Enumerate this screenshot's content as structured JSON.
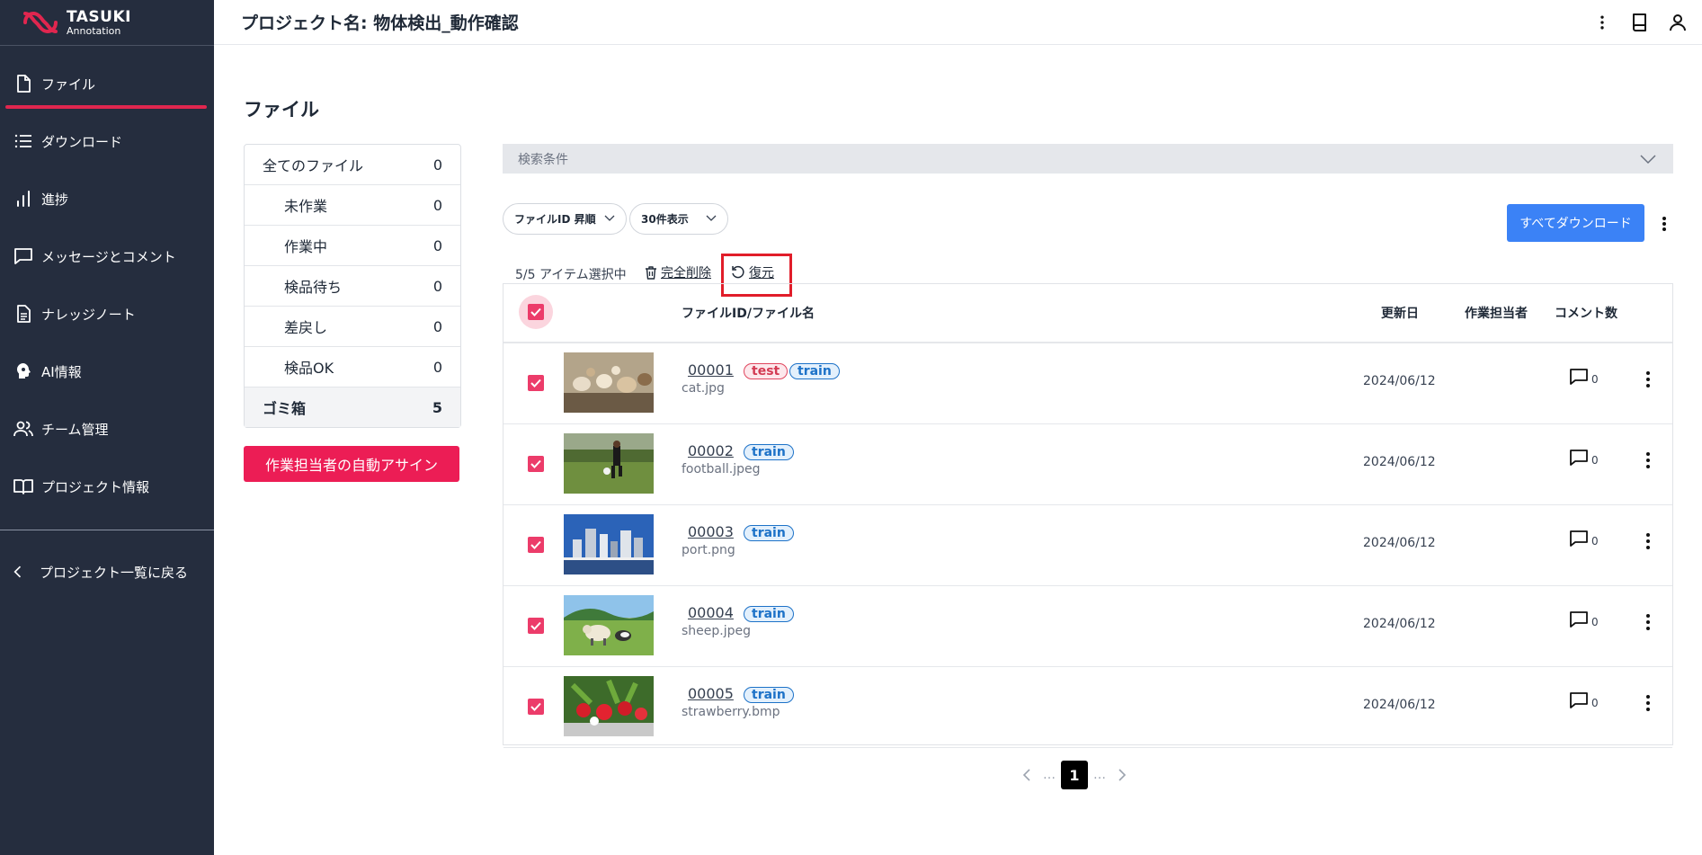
{
  "app": {
    "logo_text": "TASUKI",
    "logo_sub": "Annotation"
  },
  "header": {
    "project_title": "プロジェクト名: 物体検出_動作確認"
  },
  "sidebar": {
    "items": [
      {
        "label": "ファイル",
        "icon": "file-icon",
        "active": true
      },
      {
        "label": "ダウンロード",
        "icon": "list-icon"
      },
      {
        "label": "進捗",
        "icon": "bar-chart-icon"
      },
      {
        "label": "メッセージとコメント",
        "icon": "message-icon"
      },
      {
        "label": "ナレッジノート",
        "icon": "document-icon"
      },
      {
        "label": "AI情報",
        "icon": "ai-head-icon"
      },
      {
        "label": "チーム管理",
        "icon": "users-icon"
      },
      {
        "label": "プロジェクト情報",
        "icon": "book-icon"
      }
    ],
    "back_label": "プロジェクト一覧に戻る"
  },
  "main": {
    "section_title": "ファイル",
    "filters": [
      {
        "label": "全てのファイル",
        "count": "0"
      },
      {
        "label": "未作業",
        "count": "0"
      },
      {
        "label": "作業中",
        "count": "0"
      },
      {
        "label": "検品待ち",
        "count": "0"
      },
      {
        "label": "差戻し",
        "count": "0"
      },
      {
        "label": "検品OK",
        "count": "0"
      },
      {
        "label": "ゴミ箱",
        "count": "5"
      }
    ],
    "auto_assign_label": "作業担当者の自動アサイン",
    "search_label": "検索条件",
    "sort_select": "ファイルID 昇順",
    "page_size_select": "30件表示",
    "download_all_label": "すべてダウンロード",
    "selection_text": "5/5 アイテム選択中",
    "delete_label": "完全削除",
    "restore_label": "復元",
    "columns": {
      "file": "ファイルID/ファイル名",
      "updated": "更新日",
      "assignee": "作業担当者",
      "comments": "コメント数"
    },
    "rows": [
      {
        "id": "00001",
        "name": "cat.jpg",
        "tags": [
          "test",
          "train"
        ],
        "date": "2024/06/12",
        "comments": "0"
      },
      {
        "id": "00002",
        "name": "football.jpeg",
        "tags": [
          "train"
        ],
        "date": "2024/06/12",
        "comments": "0"
      },
      {
        "id": "00003",
        "name": "port.png",
        "tags": [
          "train"
        ],
        "date": "2024/06/12",
        "comments": "0"
      },
      {
        "id": "00004",
        "name": "sheep.jpeg",
        "tags": [
          "train"
        ],
        "date": "2024/06/12",
        "comments": "0"
      },
      {
        "id": "00005",
        "name": "strawberry.bmp",
        "tags": [
          "train"
        ],
        "date": "2024/06/12",
        "comments": "0"
      }
    ],
    "pagination": {
      "current": "1",
      "dots": "…"
    }
  },
  "colors": {
    "sidebar_bg": "#252d3e",
    "accent_pink": "#ec1d55",
    "primary_blue": "#3b82f6",
    "highlight_red": "#e11d2a"
  }
}
